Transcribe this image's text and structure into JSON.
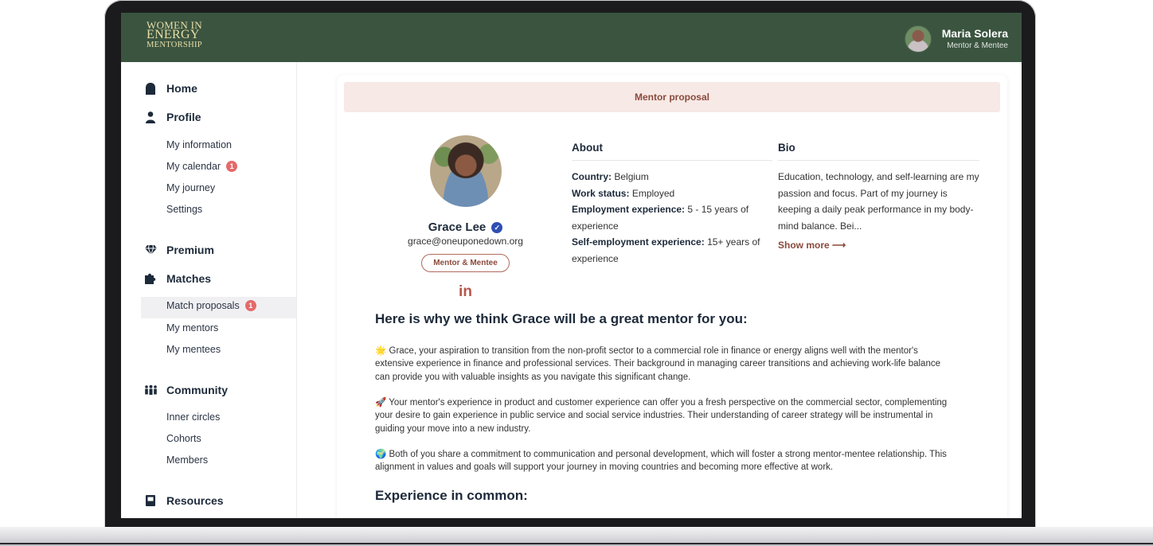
{
  "header": {
    "logo": {
      "line1": "WOMEN IN",
      "line2": "ENERGY",
      "line3": "MENTORSHIP"
    },
    "user": {
      "name": "Maria Solera",
      "role": "Mentor & Mentee"
    }
  },
  "sidebar": {
    "home": "Home",
    "profile": "Profile",
    "profile_items": [
      "My information",
      "My calendar",
      "My journey",
      "Settings"
    ],
    "calendar_badge": "1",
    "premium": "Premium",
    "matches": "Matches",
    "matches_items": [
      "Match proposals",
      "My mentors",
      "My mentees"
    ],
    "proposals_badge": "1",
    "community": "Community",
    "community_items": [
      "Inner circles",
      "Cohorts",
      "Members"
    ],
    "resources": "Resources"
  },
  "main": {
    "banner": "Mentor proposal",
    "profile": {
      "name": "Grace Lee",
      "email": "grace@oneuponedown.org",
      "tag": "Mentor & Mentee",
      "linkedin": "in"
    },
    "about": {
      "title": "About",
      "country_label": "Country:",
      "country": "Belgium",
      "work_label": "Work status:",
      "work": "Employed",
      "employment_label": "Employment experience:",
      "employment": "5 - 15 years of experience",
      "self_label": "Self-employment experience:",
      "self": "15+ years of experience"
    },
    "bio": {
      "title": "Bio",
      "text": "Education, technology, and self-learning are my passion and focus. Part of my journey is keeping a daily peak performance in my body-mind balance. Bei...",
      "show_more": "Show more ⟶"
    },
    "why_title": "Here is why we think Grace will be a great mentor for you:",
    "reasons": [
      "🌟 Grace, your aspiration to transition from the non-profit sector to a commercial role in finance or energy aligns well with the mentor's extensive experience in finance and professional services. Their background in managing career transitions and achieving work-life balance can provide you with valuable insights as you navigate this significant change.",
      "🚀 Your mentor's experience in product and customer experience can offer you a fresh perspective on the commercial sector, complementing your desire to gain experience in public service and social service industries. Their understanding of career strategy will be instrumental in guiding your move into a new industry.",
      "🌍 Both of you share a commitment to communication and personal development, which will foster a strong mentor-mentee relationship. This alignment in values and goals will support your journey in moving countries and becoming more effective at work."
    ],
    "experience_title": "Experience in common:"
  }
}
